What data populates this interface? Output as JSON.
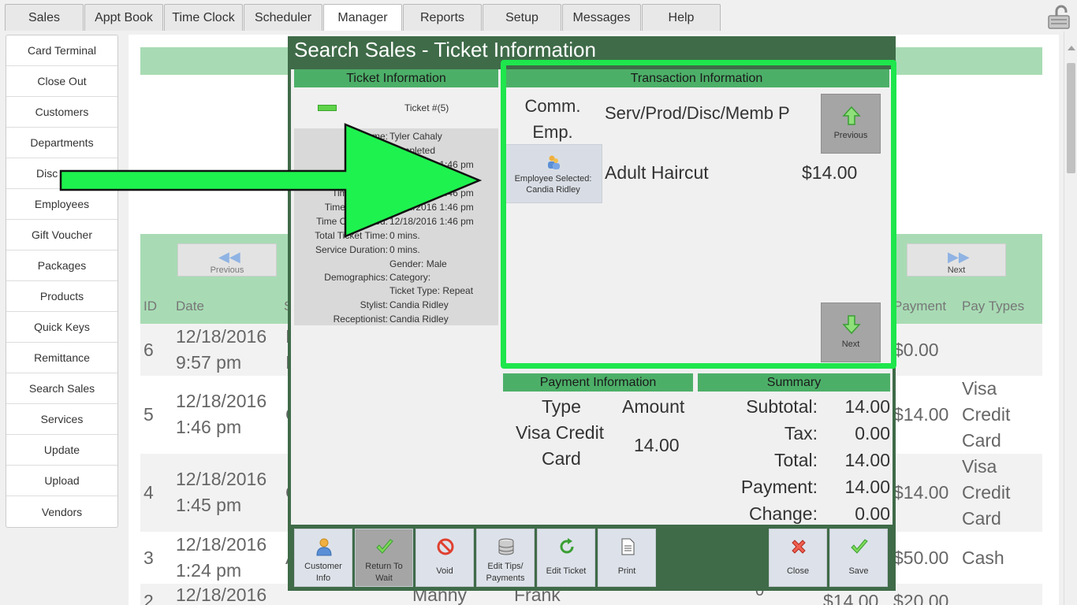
{
  "tabs": [
    {
      "label": "Sales",
      "active": false
    },
    {
      "label": "Appt Book",
      "active": false
    },
    {
      "label": "Time Clock",
      "active": false
    },
    {
      "label": "Scheduler",
      "active": false
    },
    {
      "label": "Manager",
      "active": true
    },
    {
      "label": "Reports",
      "active": false
    },
    {
      "label": "Setup",
      "active": false
    },
    {
      "label": "Messages",
      "active": false
    },
    {
      "label": "Help",
      "active": false
    }
  ],
  "sidebar": {
    "items": [
      "Card Terminal",
      "Close Out",
      "Customers",
      "Departments",
      "Disc",
      "Employees",
      "Gift Voucher",
      "Packages",
      "Products",
      "Quick Keys",
      "Remittance",
      "Search Sales",
      "Services",
      "Update",
      "Upload",
      "Vendors"
    ]
  },
  "background": {
    "prev_label": "Previous",
    "next_label": "Next",
    "headers": {
      "id": "ID",
      "date": "Date",
      "s": "S",
      "payment": "Payment",
      "pay_types": "Pay Types"
    },
    "rows": [
      {
        "id": "6",
        "date1": "12/18/2016",
        "date2": "9:57 pm",
        "s": "I",
        "s2": "I",
        "payment": "$0.00",
        "pay1": "",
        "pay2": "",
        "pay3": ""
      },
      {
        "id": "5",
        "date1": "12/18/2016",
        "date2": "1:46 pm",
        "s": "C",
        "s2": "",
        "payment": "$14.00",
        "pay1": "Visa",
        "pay2": "Credit",
        "pay3": "Card"
      },
      {
        "id": "4",
        "date1": "12/18/2016",
        "date2": "1:45 pm",
        "s": "C",
        "s2": "",
        "payment": "$14.00",
        "pay1": "Visa",
        "pay2": "Credit",
        "pay3": "Card"
      },
      {
        "id": "3",
        "date1": "12/18/2016",
        "date2": "1:24 pm",
        "s": "A",
        "s2": "",
        "payment": "$50.00",
        "pay1": "Cash",
        "pay2": "",
        "pay3": ""
      },
      {
        "id": "2",
        "date1": "12/18/2016",
        "date2": "",
        "s": "",
        "s2": "",
        "payment": "$20.00",
        "pay1": "",
        "pay2": "",
        "pay3": ""
      }
    ],
    "partial_row": {
      "a": "Manny",
      "b": "Frank",
      "c": "0",
      "d": "$14.00"
    }
  },
  "modal": {
    "title": "Search Sales - Ticket Information",
    "ticket": {
      "heading": "Ticket Information",
      "number": "Ticket #(5)",
      "fields": [
        {
          "k": "Name:",
          "v": "Tyler Cahaly"
        },
        {
          "k": "Status:",
          "v": "Completed"
        },
        {
          "k": "Timein:",
          "v": "12/18/2016 1:46 pm"
        },
        {
          "k": "",
          "v": "12/18/2016 1:46 pm"
        },
        {
          "k": "Time Served:",
          "v": "12/18/2016 1:46 pm"
        },
        {
          "k": "Time Checked:",
          "v": "12/18/2016 1:46 pm"
        },
        {
          "k": "Time Completed:",
          "v": "12/18/2016 1:46 pm"
        },
        {
          "k": "Total Ticket Time:",
          "v": "0 mins."
        },
        {
          "k": "Service Duration:",
          "v": "0 mins."
        },
        {
          "k": "",
          "v": "Gender: Male"
        },
        {
          "k": "Demographics:",
          "v": "Category:"
        },
        {
          "k": "",
          "v": "Ticket Type: Repeat"
        },
        {
          "k": "Stylist:",
          "v": "Candia Ridley"
        },
        {
          "k": "Receptionist:",
          "v": "Candia Ridley"
        }
      ]
    },
    "transaction": {
      "heading": "Transaction Information",
      "comm_line1": "Comm.",
      "comm_line2": "Emp.",
      "col_header": "Serv/Prod/Disc/Memb  P",
      "employee_line1": "Employee Selected:",
      "employee_line2": "Candia Ridley",
      "item_name": "Adult Haircut",
      "item_price": "$14.00",
      "prev_label": "Previous",
      "next_label": "Next"
    },
    "payment": {
      "heading": "Payment Information",
      "type_header": "Type",
      "amount_header": "Amount",
      "type_line1": "Visa Credit",
      "type_line2": "Card",
      "amount": "14.00"
    },
    "summary": {
      "heading": "Summary",
      "subtotal_label": "Subtotal:",
      "subtotal": "14.00",
      "tax_label": "Tax:",
      "tax": "0.00",
      "total_label": "Total:",
      "total": "14.00",
      "payment_label": "Payment:",
      "payment": "14.00",
      "change_label": "Change:",
      "change": "0.00"
    },
    "toolbar": {
      "customer_info_1": "Customer",
      "customer_info_2": "Info",
      "return_wait_1": "Return To",
      "return_wait_2": "Wait",
      "void": "Void",
      "edit_tips_1": "Edit Tips/",
      "edit_tips_2": "Payments",
      "edit_ticket": "Edit Ticket",
      "print": "Print",
      "close": "Close",
      "save": "Save"
    }
  },
  "colors": {
    "accent_green": "#4caf68",
    "highlight": "#1ee64c",
    "modal_bg": "#3f6b48"
  }
}
